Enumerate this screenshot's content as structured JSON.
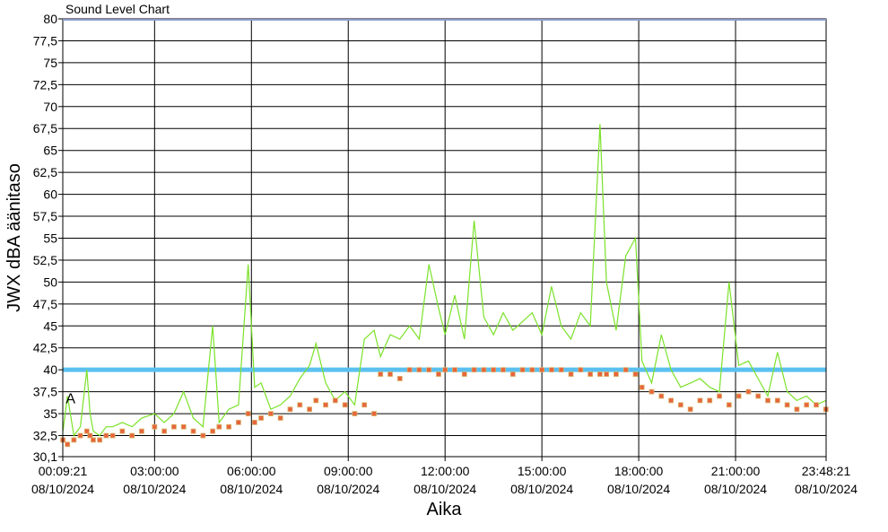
{
  "chart_data": {
    "type": "line",
    "title": "Sound Level Chart",
    "xlabel": "Aika",
    "ylabel": "JWX dBA äänitaso",
    "ylim": [
      30.1,
      80
    ],
    "yticks": [
      "80",
      "77,5",
      "75",
      "72,5",
      "70",
      "67,5",
      "65",
      "62,5",
      "60",
      "57,5",
      "55",
      "52,5",
      "50",
      "47,5",
      "45",
      "42,5",
      "40",
      "37,5",
      "35",
      "32,5",
      "30,1"
    ],
    "ytick_values": [
      80,
      77.5,
      75,
      72.5,
      70,
      67.5,
      65,
      62.5,
      60,
      57.5,
      55,
      52.5,
      50,
      47.5,
      45,
      42.5,
      40,
      37.5,
      35,
      32.5,
      30.1
    ],
    "xlim": [
      0.1558,
      23.8058
    ],
    "xtick_hours": [
      0.1558,
      3,
      6,
      9,
      12,
      15,
      18,
      21,
      23.8058
    ],
    "xticks": [
      {
        "time": "00:09:21",
        "date": "08/10/2024"
      },
      {
        "time": "03:00:00",
        "date": "08/10/2024"
      },
      {
        "time": "06:00:00",
        "date": "08/10/2024"
      },
      {
        "time": "09:00:00",
        "date": "08/10/2024"
      },
      {
        "time": "12:00:00",
        "date": "08/10/2024"
      },
      {
        "time": "15:00:00",
        "date": "08/10/2024"
      },
      {
        "time": "18:00:00",
        "date": "08/10/2024"
      },
      {
        "time": "21:00:00",
        "date": "08/10/2024"
      },
      {
        "time": "23:48:21",
        "date": "08/10/2024"
      }
    ],
    "grid": true,
    "threshold": {
      "value": 40,
      "color": "#5bc0f0"
    },
    "annotation": {
      "text": "A",
      "hour": 0.25,
      "value": 36.2
    },
    "colors": {
      "line": "#7be22a",
      "marker_fill": "#e8643c",
      "marker_edge": "#d9b46a",
      "grid": "#000000",
      "top_line": "#8a9bc8"
    },
    "series": [
      {
        "kind": "line",
        "x": [
          0.16,
          0.3,
          0.5,
          0.7,
          0.9,
          1.0,
          1.1,
          1.3,
          1.5,
          1.7,
          2.0,
          2.3,
          2.6,
          3.0,
          3.3,
          3.6,
          3.9,
          4.2,
          4.5,
          4.8,
          5.0,
          5.3,
          5.6,
          5.9,
          6.1,
          6.3,
          6.6,
          6.9,
          7.2,
          7.5,
          7.8,
          8.0,
          8.3,
          8.6,
          8.9,
          9.2,
          9.5,
          9.8,
          10.0,
          10.3,
          10.6,
          10.9,
          11.2,
          11.5,
          11.8,
          12.0,
          12.3,
          12.6,
          12.9,
          13.2,
          13.5,
          13.8,
          14.1,
          14.4,
          14.7,
          15.0,
          15.3,
          15.6,
          15.9,
          16.2,
          16.5,
          16.8,
          17.0,
          17.3,
          17.6,
          17.9,
          18.1,
          18.4,
          18.7,
          19.0,
          19.3,
          19.6,
          19.9,
          20.2,
          20.5,
          20.8,
          21.1,
          21.4,
          21.7,
          22.0,
          22.3,
          22.6,
          22.9,
          23.2,
          23.5,
          23.8
        ],
        "values": [
          33,
          37,
          32.5,
          33.5,
          40,
          35,
          33,
          32.5,
          33.5,
          33.5,
          34,
          33.5,
          34.5,
          35,
          34,
          35,
          37.5,
          34.5,
          33.5,
          45,
          34,
          35.5,
          36,
          52,
          38,
          38.5,
          35.5,
          36,
          37,
          39,
          40.5,
          43,
          38.5,
          36.5,
          37.5,
          36,
          43.5,
          44.5,
          41.5,
          44,
          43.5,
          45,
          43.5,
          52,
          47,
          44,
          48.5,
          43.5,
          57,
          46,
          44,
          46.5,
          44.5,
          45.5,
          46.5,
          44,
          49.5,
          45,
          43.5,
          46.5,
          45,
          68,
          50,
          44.5,
          53,
          55,
          41,
          38.5,
          44,
          40,
          38,
          38.5,
          39,
          38,
          37.5,
          50,
          40.5,
          41,
          39,
          37,
          42,
          37.5,
          36.5,
          37,
          36,
          36.5
        ]
      },
      {
        "kind": "markers",
        "x": [
          0.16,
          0.3,
          0.5,
          0.7,
          0.9,
          1.0,
          1.1,
          1.3,
          1.5,
          1.7,
          2.0,
          2.3,
          2.6,
          3.0,
          3.3,
          3.6,
          3.9,
          4.2,
          4.5,
          4.8,
          5.0,
          5.3,
          5.6,
          5.9,
          6.1,
          6.3,
          6.6,
          6.9,
          7.2,
          7.5,
          7.8,
          8.0,
          8.3,
          8.6,
          8.9,
          9.2,
          9.5,
          9.8,
          10.0,
          10.3,
          10.6,
          10.9,
          11.2,
          11.5,
          11.8,
          12.0,
          12.3,
          12.6,
          12.9,
          13.2,
          13.5,
          13.8,
          14.1,
          14.4,
          14.7,
          15.0,
          15.3,
          15.6,
          15.9,
          16.2,
          16.5,
          16.8,
          17.0,
          17.3,
          17.6,
          17.9,
          18.1,
          18.4,
          18.7,
          19.0,
          19.3,
          19.6,
          19.9,
          20.2,
          20.5,
          20.8,
          21.1,
          21.4,
          21.7,
          22.0,
          22.3,
          22.6,
          22.9,
          23.2,
          23.5,
          23.8
        ],
        "values": [
          32,
          31.5,
          32,
          32.5,
          33,
          32.5,
          32,
          32,
          32.5,
          32.5,
          33,
          32.5,
          33,
          33.5,
          33,
          33.5,
          33.5,
          33,
          32.5,
          33,
          33.5,
          33.5,
          34,
          35,
          34,
          34.5,
          35,
          34.5,
          35.5,
          36,
          35.5,
          36.5,
          36,
          36.5,
          36,
          35,
          36,
          35,
          39.5,
          39.5,
          39,
          40,
          40,
          40,
          39.5,
          40,
          40,
          39.5,
          40,
          40,
          40,
          40,
          39.5,
          40,
          40,
          40,
          40,
          40,
          39.5,
          40,
          39.5,
          39.5,
          39.5,
          39.5,
          40,
          39.5,
          38,
          37.5,
          37,
          36.5,
          36,
          35.5,
          36.5,
          36.5,
          37,
          36,
          37,
          37.5,
          37,
          36.5,
          36.5,
          36,
          35.5,
          36,
          36,
          35.5
        ]
      }
    ]
  }
}
